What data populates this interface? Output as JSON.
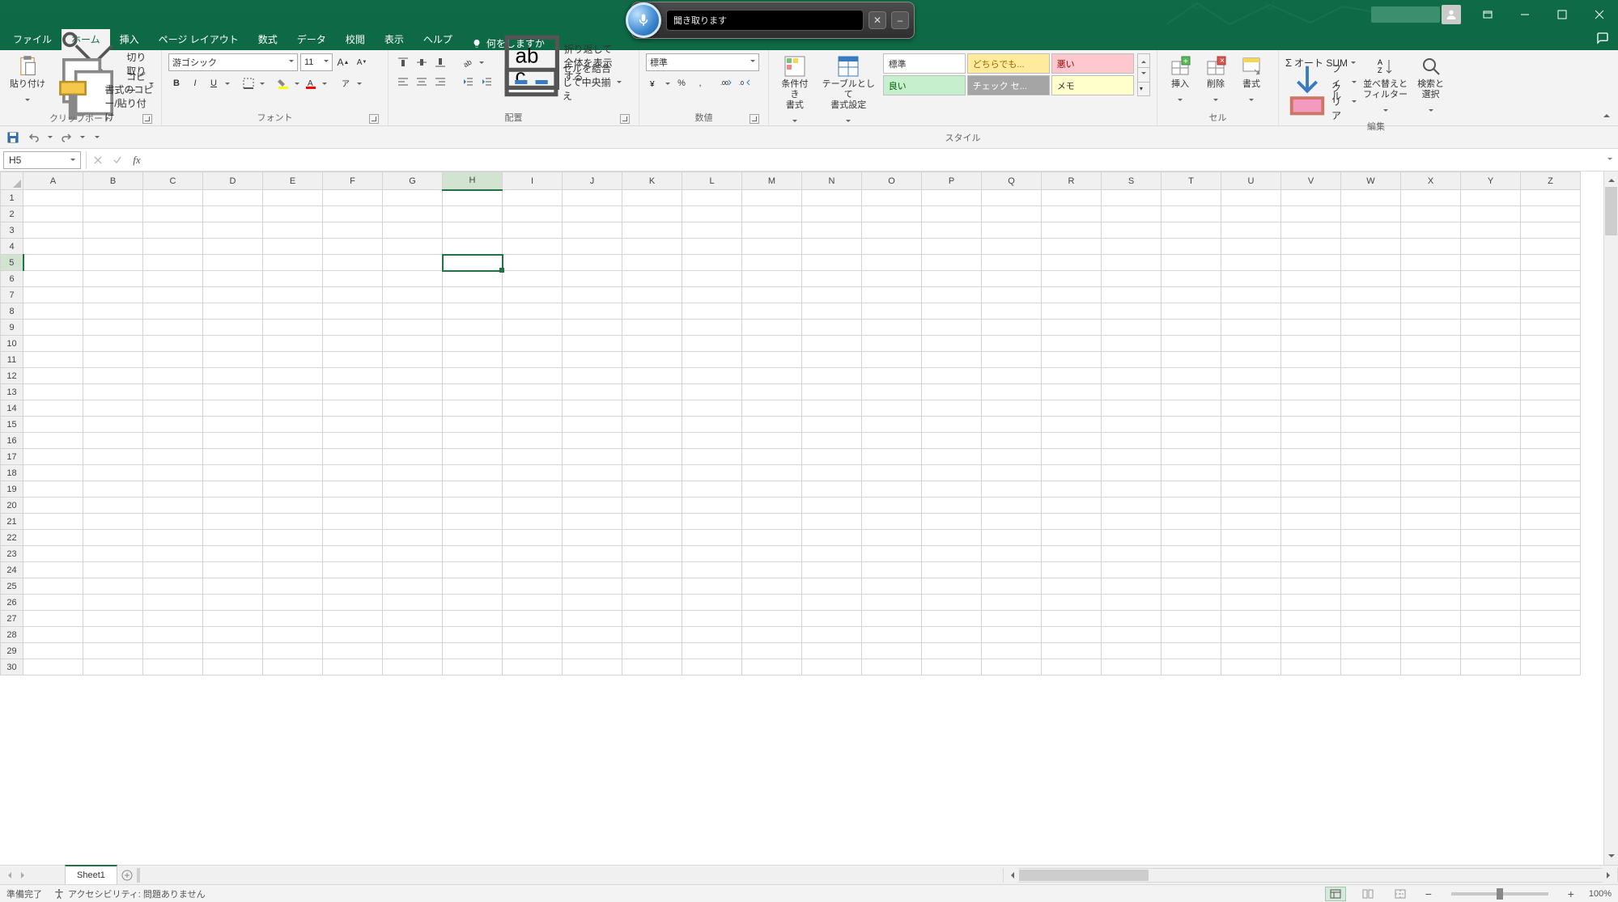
{
  "window": {
    "comments_icon": "comments"
  },
  "voice": {
    "text": "聞き取ります"
  },
  "tabs": {
    "file": "ファイル",
    "home": "ホーム",
    "insert": "挿入",
    "layout": "ページ レイアウト",
    "formulas": "数式",
    "data": "データ",
    "review": "校閲",
    "view": "表示",
    "help": "ヘルプ",
    "tell_me": "何をしますか"
  },
  "ribbon": {
    "clipboard": {
      "paste": "貼り付け",
      "cut": "切り取り",
      "copy": "コピー",
      "format_painter": "書式のコピー/貼り付け",
      "label": "クリップボード"
    },
    "font": {
      "name": "游ゴシック",
      "size": "11",
      "label": "フォント"
    },
    "alignment": {
      "wrap": "折り返して全体を表示する",
      "merge": "セルを結合して中央揃え",
      "label": "配置"
    },
    "number": {
      "format": "標準",
      "label": "数値"
    },
    "styles": {
      "cond": "条件付き\n書式",
      "table": "テーブルとして\n書式設定",
      "cells": [
        "標準",
        "どちらでも...",
        "悪い",
        "良い",
        "チェック セ...",
        "メモ"
      ],
      "label": "スタイル"
    },
    "cells_grp": {
      "insert": "挿入",
      "delete": "削除",
      "format": "書式",
      "label": "セル"
    },
    "editing": {
      "autosum": "オート SUM",
      "fill": "フィル",
      "clear": "クリア",
      "sort": "並べ替えと\nフィルター",
      "find": "検索と\n選択",
      "label": "編集"
    }
  },
  "namebox": "H5",
  "columns": [
    "A",
    "B",
    "C",
    "D",
    "E",
    "F",
    "G",
    "H",
    "I",
    "J",
    "K",
    "L",
    "M",
    "N",
    "O",
    "P",
    "Q",
    "R",
    "S",
    "T",
    "U",
    "V",
    "W",
    "X",
    "Y",
    "Z"
  ],
  "rows": 30,
  "active": {
    "col": "H",
    "row": 5
  },
  "sheet_tabs": {
    "sheet1": "Sheet1"
  },
  "statusbar": {
    "ready": "準備完了",
    "a11y": "アクセシビリティ: 問題ありません",
    "zoom": "100%"
  }
}
